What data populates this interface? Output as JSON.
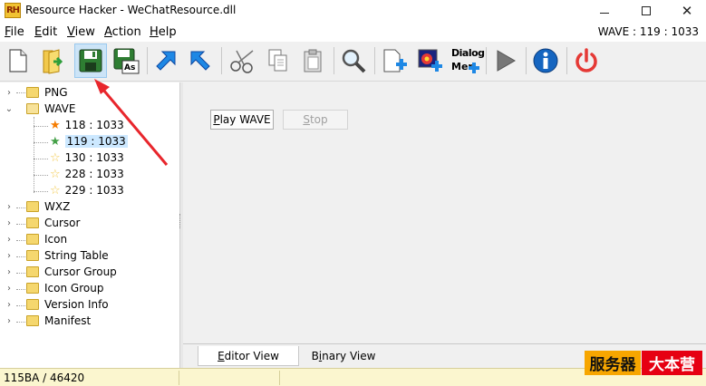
{
  "window": {
    "title": "Resource Hacker - WeChatResource.dll",
    "app_icon_text": "RH"
  },
  "menu": {
    "items": [
      {
        "label": "File",
        "key": "F",
        "rest": "ile"
      },
      {
        "label": "Edit",
        "key": "E",
        "rest": "dit"
      },
      {
        "label": "View",
        "key": "V",
        "rest": "iew"
      },
      {
        "label": "Action",
        "key": "A",
        "rest": "ction"
      },
      {
        "label": "Help",
        "key": "H",
        "rest": "elp"
      }
    ],
    "status": "WAVE : 119 : 1033"
  },
  "toolbar": {
    "dialog_menu_label_1": "Dialog",
    "dialog_menu_label_2": "Mer",
    "save_as_label": "As",
    "icons": [
      "new-file-icon",
      "open-folder-icon",
      "save-icon",
      "save-as-icon",
      "compile-icon",
      "bookmark-icon",
      "cut-icon",
      "copy-icon",
      "paste-icon",
      "search-icon",
      "add-resource-icon",
      "add-image-icon",
      "dialog-menu-icon",
      "play-icon",
      "info-icon",
      "power-icon"
    ]
  },
  "tree": {
    "nodes": [
      {
        "label": "PNG",
        "level": 0,
        "expander": "›"
      },
      {
        "label": "WAVE",
        "level": 0,
        "expander": "⌄"
      },
      {
        "label": "118 : 1033",
        "level": 1
      },
      {
        "label": "119 : 1033",
        "level": 1,
        "selected": true
      },
      {
        "label": "130 : 1033",
        "level": 1
      },
      {
        "label": "228 : 1033",
        "level": 1
      },
      {
        "label": "229 : 1033",
        "level": 1
      },
      {
        "label": "WXZ",
        "level": 0,
        "expander": "›"
      },
      {
        "label": "Cursor",
        "level": 0,
        "expander": "›"
      },
      {
        "label": "Icon",
        "level": 0,
        "expander": "›"
      },
      {
        "label": "String Table",
        "level": 0,
        "expander": "›"
      },
      {
        "label": "Cursor Group",
        "level": 0,
        "expander": "›"
      },
      {
        "label": "Icon Group",
        "level": 0,
        "expander": "›"
      },
      {
        "label": "Version Info",
        "level": 0,
        "expander": "›"
      },
      {
        "label": "Manifest",
        "level": 0,
        "expander": "›"
      }
    ]
  },
  "editor": {
    "play_label": "Play WAVE",
    "play_key": "P",
    "play_rest": "lay WAVE",
    "stop_label": "Stop",
    "stop_key": "S",
    "stop_rest": "top"
  },
  "tabs": [
    {
      "label": "Editor View",
      "key": "E",
      "rest": "ditor View",
      "active": true
    },
    {
      "label": "Binary View",
      "pre": "B",
      "key": "i",
      "rest": "nary View",
      "active": false
    }
  ],
  "statusbar": {
    "text": "115BA / 46420"
  },
  "watermark": {
    "part1": "服务器",
    "part2": "大本营"
  },
  "colors": {
    "selection": "#cce8ff",
    "status_bg": "#fbf6cf",
    "arrow": "#e8262c",
    "pressed": "#cce4f7"
  }
}
